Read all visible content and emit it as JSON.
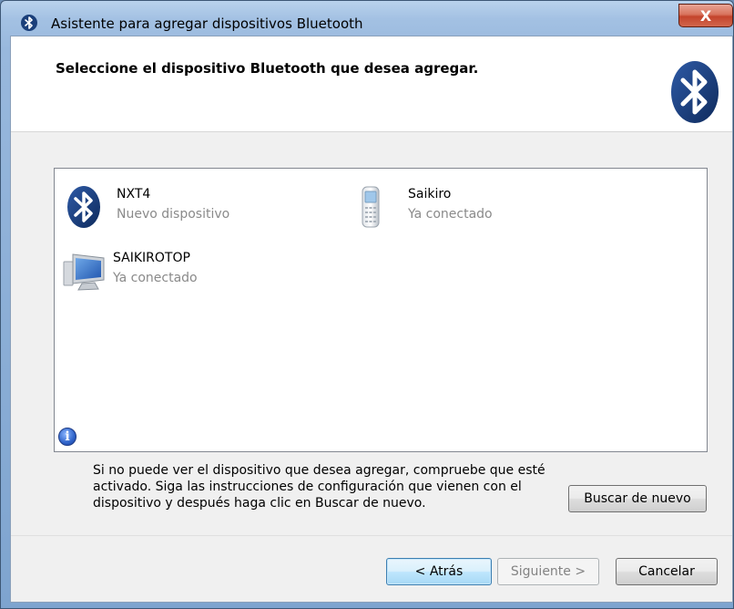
{
  "window": {
    "title": "Asistente para agregar dispositivos Bluetooth",
    "close_label": "X"
  },
  "header": {
    "title": "Seleccione el dispositivo Bluetooth que desea agregar."
  },
  "devices": [
    {
      "name": "NXT4",
      "status": "Nuevo dispositivo",
      "icon": "bluetooth-icon"
    },
    {
      "name": "Saikiro",
      "status": "Ya conectado",
      "icon": "phone-icon"
    },
    {
      "name": "SAIKIROTOP",
      "status": "Ya conectado",
      "icon": "computer-icon"
    }
  ],
  "info": {
    "icon": "info-icon",
    "text": "Si no puede ver el dispositivo que desea agregar, compruebe que esté activado. Siga las instrucciones de configuración que vienen con el dispositivo y después haga clic en Buscar de nuevo."
  },
  "buttons": {
    "search_again": "Buscar de nuevo",
    "back": "< Atrás",
    "next": "Siguiente >",
    "cancel": "Cancelar"
  },
  "colors": {
    "bluetooth_blue": "#1a3f7a",
    "titlebar": "#a3c1e3",
    "close_red": "#c4442c"
  }
}
